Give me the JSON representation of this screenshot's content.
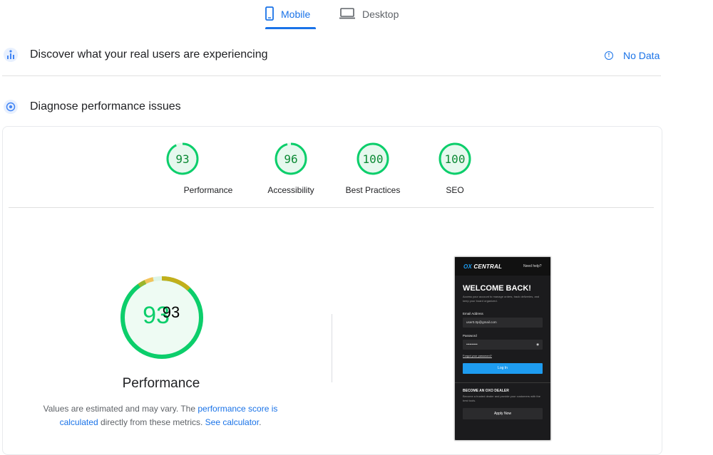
{
  "tabs": [
    {
      "label": "Mobile",
      "active": true,
      "icon": "mobile-phone-icon"
    },
    {
      "label": "Desktop",
      "active": false,
      "icon": "desktop-icon"
    }
  ],
  "field_data": {
    "title": "Discover what your real users are experiencing",
    "status": "No Data"
  },
  "diagnose": {
    "title": "Diagnose performance issues"
  },
  "scores": [
    {
      "label": "Performance",
      "value": "93",
      "fraction": 0.93
    },
    {
      "label": "Accessibility",
      "value": "96",
      "fraction": 0.96
    },
    {
      "label": "Best Practices",
      "value": "100",
      "fraction": 1.0
    },
    {
      "label": "SEO",
      "value": "100",
      "fraction": 1.0
    }
  ],
  "performance_detail": {
    "score": "93",
    "title": "Performance",
    "desc_prefix": "Values are estimated and may vary. The ",
    "link1": "performance score is calculated",
    "desc_middle": " directly from these metrics. ",
    "link2": "See calculator",
    "desc_suffix": "."
  },
  "phone_screenshot": {
    "logo_ox": "OX",
    "logo_rest": "CENTRAL",
    "help": "Need help?",
    "welcome": "WELCOME BACK!",
    "subtitle": "Access your account to manage orders, track deliveries, and keep your board organized.",
    "email_label": "Email Address",
    "email_value": "user0.0p@gmail.com",
    "password_label": "Password",
    "password_value": "••••••••••",
    "forgot": "Forgot your password?",
    "login": "Log In",
    "become_title": "BECOME AN OXO DEALER",
    "become_sub": "Become a trusted dealer and provide your customers with the best tools.",
    "apply": "Apply Now"
  },
  "colors": {
    "accent": "#1a73e8",
    "pass": "#0cce6b",
    "pass_text": "#0c8a35",
    "average": "#ffa400"
  }
}
